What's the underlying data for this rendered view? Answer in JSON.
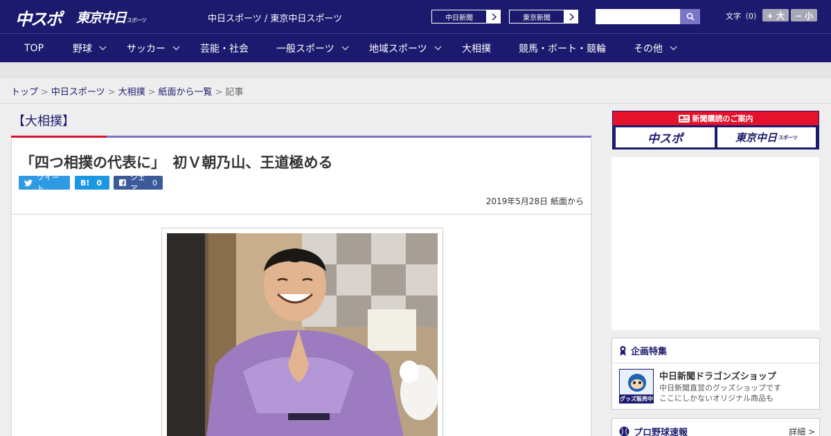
{
  "header": {
    "logo_main": "中スポ",
    "logo_tokyo": "東京中日",
    "logo_tokyo_small": "スポーツ",
    "tagline": "中日スポーツ / 東京中日スポーツ",
    "ext_links": [
      {
        "label": "中日新聞"
      },
      {
        "label": "東京新聞"
      }
    ],
    "search": {
      "placeholder": ""
    },
    "font_size": {
      "label": "文字（0）",
      "bigger": "+ 大",
      "smaller": "− 小"
    }
  },
  "nav": {
    "items": [
      {
        "label": "TOP",
        "has_menu": false
      },
      {
        "label": "野球",
        "has_menu": true
      },
      {
        "label": "サッカー",
        "has_menu": true
      },
      {
        "label": "芸能・社会",
        "has_menu": false
      },
      {
        "label": "一般スポーツ",
        "has_menu": true
      },
      {
        "label": "地域スポーツ",
        "has_menu": true
      },
      {
        "label": "大相撲",
        "has_menu": false
      },
      {
        "label": "競馬・ボート・競輪",
        "has_menu": false
      },
      {
        "label": "その他",
        "has_menu": true
      }
    ]
  },
  "breadcrumb": {
    "items": [
      "トップ",
      "中日スポーツ",
      "大相撲",
      "紙面から一覧"
    ],
    "current": "記事",
    "separator": ">"
  },
  "article": {
    "category": "【大相撲】",
    "headline": "「四つ相撲の代表に」　初Ｖ朝乃山、王道極める",
    "share": {
      "tweet": "ツイート",
      "hatena_label": "B!",
      "hatena_count": "0",
      "facebook": "シェア",
      "facebook_count": "0"
    },
    "dateline": "2019年5月28日 紙面から"
  },
  "sidebar": {
    "subscription_banner": {
      "band": "新聞購読のご案内",
      "left": "中スポ",
      "right": "東京中日",
      "right_small": "スポーツ"
    },
    "feature": {
      "title": "企画特集",
      "shop_thumb_text": "グッズ販売中",
      "shop_title": "中日新聞ドラゴンズショップ",
      "shop_desc_1": "中日新聞直営のグッズショップです",
      "shop_desc_2": "ここにしかないオリジナル商品も"
    },
    "baseball": {
      "title": "プロ野球速報",
      "more": "詳細 >"
    }
  },
  "colors": {
    "brand_navy": "#1c1a6e",
    "accent_red": "#d7112f",
    "accent_purple": "#7b74c7",
    "twitter_blue": "#2d9ae3",
    "facebook_blue": "#3a5a99"
  }
}
